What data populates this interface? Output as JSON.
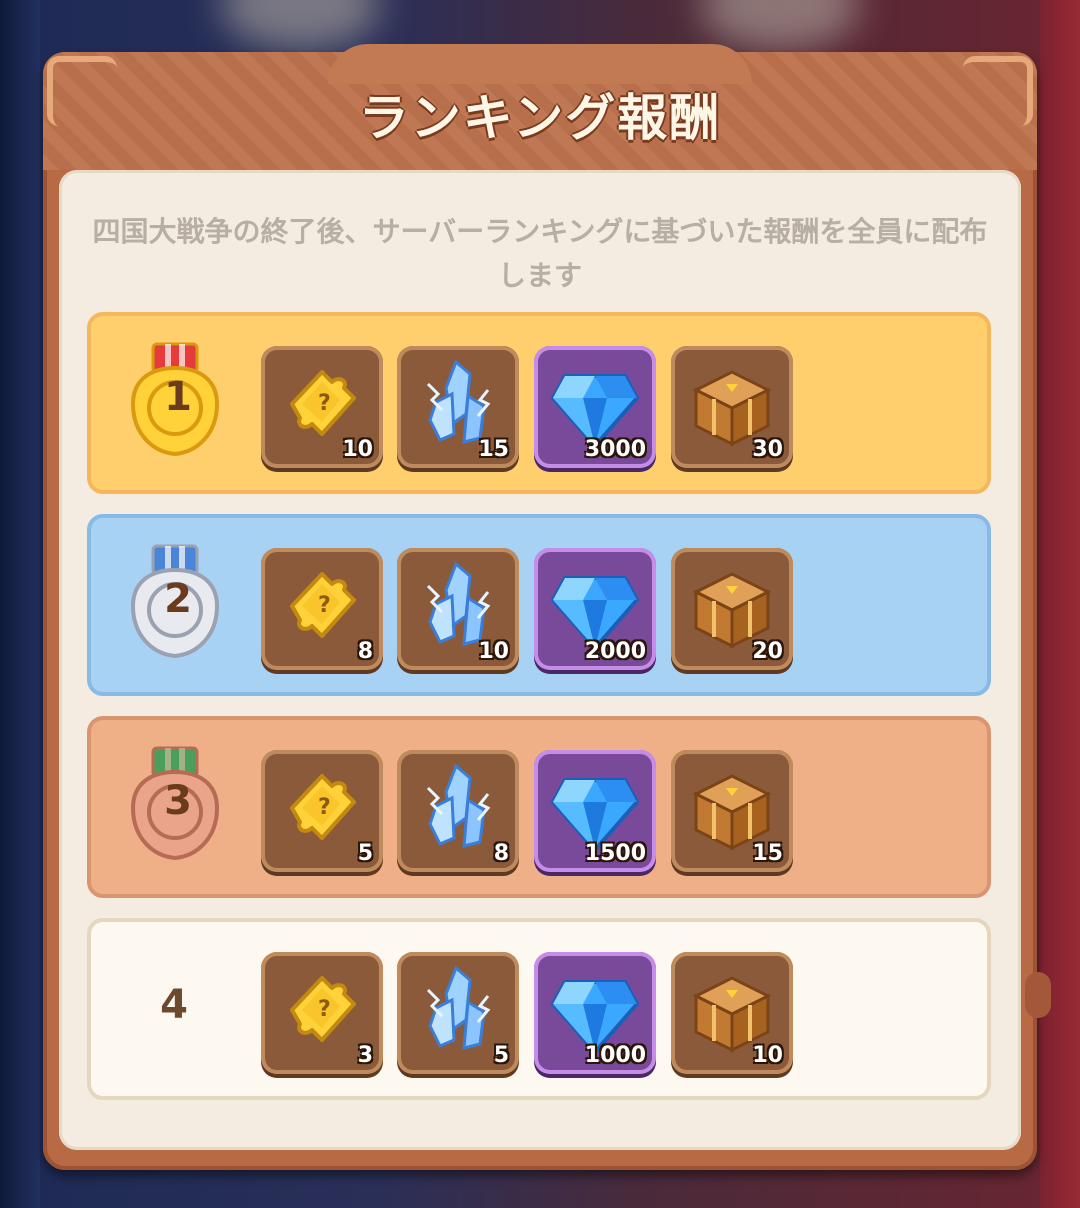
{
  "title": "ランキング報酬",
  "description": "四国大戦争の終了後、サーバーランキングに基づいた報酬を全員に配布します",
  "rows": [
    {
      "rank": "1",
      "tier": "gold",
      "rewards": [
        {
          "icon": "puzzle-ticket-icon",
          "qty": "10"
        },
        {
          "icon": "crystal-icon",
          "qty": "15"
        },
        {
          "icon": "diamond-icon",
          "qty": "3000"
        },
        {
          "icon": "treasure-chest-icon",
          "qty": "30"
        }
      ]
    },
    {
      "rank": "2",
      "tier": "silver",
      "rewards": [
        {
          "icon": "puzzle-ticket-icon",
          "qty": "8"
        },
        {
          "icon": "crystal-icon",
          "qty": "10"
        },
        {
          "icon": "diamond-icon",
          "qty": "2000"
        },
        {
          "icon": "treasure-chest-icon",
          "qty": "20"
        }
      ]
    },
    {
      "rank": "3",
      "tier": "bronze",
      "rewards": [
        {
          "icon": "puzzle-ticket-icon",
          "qty": "5"
        },
        {
          "icon": "crystal-icon",
          "qty": "8"
        },
        {
          "icon": "diamond-icon",
          "qty": "1500"
        },
        {
          "icon": "treasure-chest-icon",
          "qty": "15"
        }
      ]
    },
    {
      "rank": "4",
      "tier": "plain",
      "rewards": [
        {
          "icon": "puzzle-ticket-icon",
          "qty": "3"
        },
        {
          "icon": "crystal-icon",
          "qty": "5"
        },
        {
          "icon": "diamond-icon",
          "qty": "1000"
        },
        {
          "icon": "treasure-chest-icon",
          "qty": "10"
        }
      ]
    }
  ],
  "colors": {
    "gold": "#ffcf6e",
    "silver": "#a8d2f4",
    "bronze": "#efb088",
    "plain": "#fdf9f1",
    "frame": "#b86a45"
  }
}
